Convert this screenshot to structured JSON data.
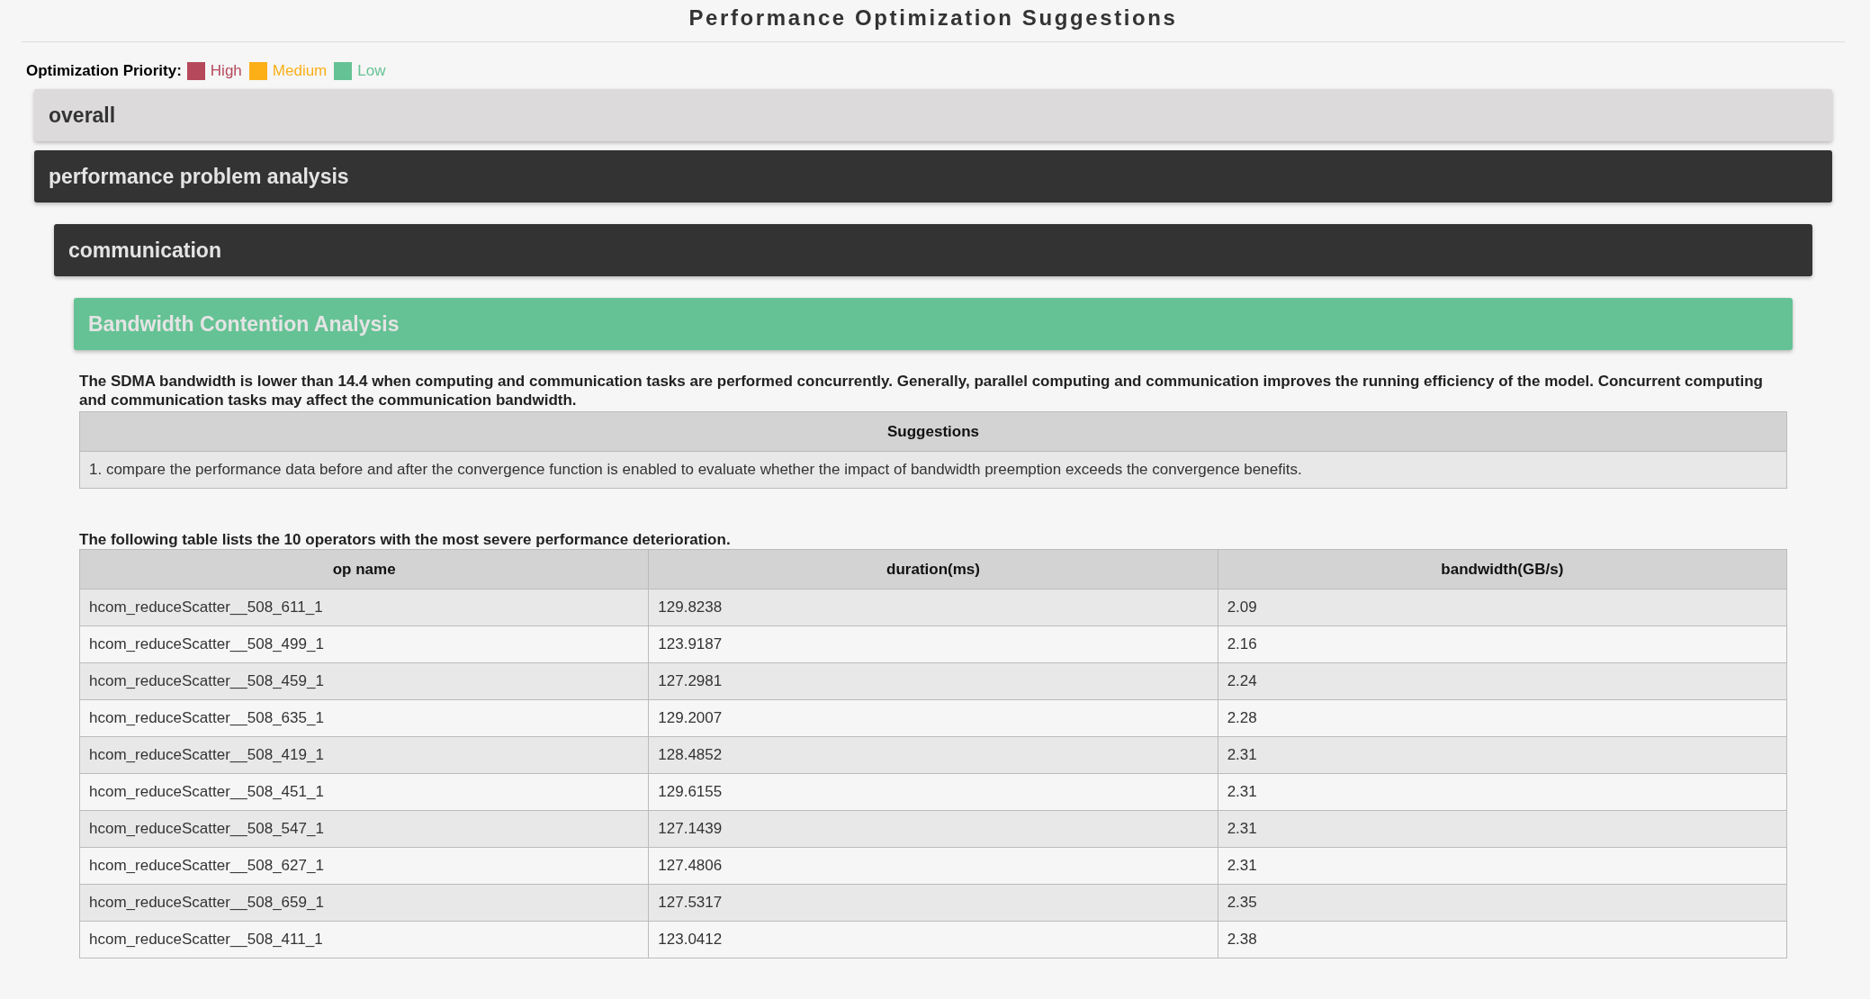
{
  "title": "Performance Optimization Suggestions",
  "legend": {
    "label": "Optimization Priority:",
    "items": [
      {
        "label": "High",
        "color": "#b5495b"
      },
      {
        "label": "Medium",
        "color": "#fcaf17"
      },
      {
        "label": "Low",
        "color": "#65c294"
      }
    ]
  },
  "sections": [
    {
      "title": "overall",
      "expanded": false
    },
    {
      "title": "performance problem analysis",
      "expanded": true,
      "children": [
        {
          "title": "communication",
          "expanded": true,
          "children": [
            {
              "title": "Bandwidth Contention Analysis",
              "expanded": true,
              "color": "#65c294",
              "description": "The SDMA bandwidth is lower than 14.4 when computing and communication tasks are performed concurrently. Generally, parallel computing and communication improves the running efficiency of the model. Concurrent computing and communication tasks may affect the communication bandwidth.",
              "suggestions": {
                "header": "Suggestions",
                "rows": [
                  "1. compare the performance data before and after the convergence function is enabled to evaluate whether the impact of bandwidth preemption exceeds the convergence benefits."
                ]
              },
              "table_caption": "The following table lists the 10 operators with the most severe performance deterioration.",
              "table": {
                "columns": [
                  "op name",
                  "duration(ms)",
                  "bandwidth(GB/s)"
                ],
                "rows": [
                  [
                    "hcom_reduceScatter__508_611_1",
                    "129.8238",
                    "2.09"
                  ],
                  [
                    "hcom_reduceScatter__508_499_1",
                    "123.9187",
                    "2.16"
                  ],
                  [
                    "hcom_reduceScatter__508_459_1",
                    "127.2981",
                    "2.24"
                  ],
                  [
                    "hcom_reduceScatter__508_635_1",
                    "129.2007",
                    "2.28"
                  ],
                  [
                    "hcom_reduceScatter__508_419_1",
                    "128.4852",
                    "2.31"
                  ],
                  [
                    "hcom_reduceScatter__508_451_1",
                    "129.6155",
                    "2.31"
                  ],
                  [
                    "hcom_reduceScatter__508_547_1",
                    "127.1439",
                    "2.31"
                  ],
                  [
                    "hcom_reduceScatter__508_627_1",
                    "127.4806",
                    "2.31"
                  ],
                  [
                    "hcom_reduceScatter__508_659_1",
                    "127.5317",
                    "2.35"
                  ],
                  [
                    "hcom_reduceScatter__508_411_1",
                    "123.0412",
                    "2.38"
                  ]
                ]
              }
            }
          ]
        }
      ]
    }
  ]
}
